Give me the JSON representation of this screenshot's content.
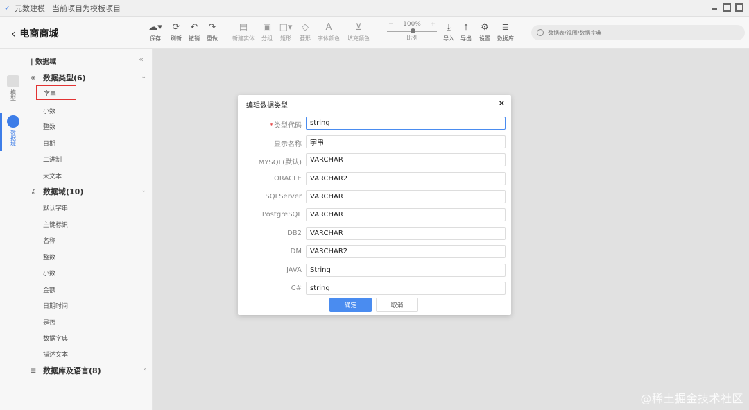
{
  "window": {
    "app_name": "元数建模",
    "project_note": "当前项目为模板项目"
  },
  "toolbar": {
    "back_title": "电商商城",
    "tools": [
      {
        "label": "保存",
        "icon": "cloud-upload-icon"
      },
      {
        "label": "刷新",
        "icon": "refresh-icon"
      },
      {
        "label": "撤销",
        "icon": "undo-icon"
      },
      {
        "label": "重做",
        "icon": "redo-icon"
      },
      {
        "label": "新建实体",
        "icon": "new-entity-icon"
      },
      {
        "label": "分组",
        "icon": "group-icon"
      },
      {
        "label": "矩形",
        "icon": "rectangle-icon"
      },
      {
        "label": "菱形",
        "icon": "diamond-icon"
      },
      {
        "label": "字体颜色",
        "icon": "font-color-icon"
      },
      {
        "label": "填充颜色",
        "icon": "fill-color-icon"
      },
      {
        "label": "导入",
        "icon": "import-icon"
      },
      {
        "label": "导出",
        "icon": "export-icon"
      },
      {
        "label": "设置",
        "icon": "gear-icon"
      },
      {
        "label": "数据库",
        "icon": "database-icon"
      }
    ],
    "zoom": {
      "minus": "−",
      "value": "100%",
      "plus": "+",
      "label": "比例"
    },
    "search_placeholder": "数据表/视图/数据字典"
  },
  "leftstrip": {
    "items": [
      {
        "label": "模型"
      },
      {
        "label": "数据域"
      }
    ]
  },
  "sidebar": {
    "header": "数据域",
    "collapse": "«",
    "groups": [
      {
        "label": "数据类型(6)",
        "icon": "cube-icon",
        "chevron": "⌄"
      },
      {
        "label": "数据域(10)",
        "icon": "key-icon",
        "chevron": "⌄"
      },
      {
        "label": "数据库及语言(8)",
        "icon": "database-icon",
        "chevron": "‹"
      }
    ],
    "data_types": [
      "字串",
      "小数",
      "整数",
      "日期",
      "二进制",
      "大文本"
    ],
    "domains": [
      "默认字串",
      "主键标识",
      "名称",
      "整数",
      "小数",
      "金额",
      "日期时间",
      "是否",
      "数据字典",
      "描述文本"
    ]
  },
  "dialog": {
    "title": "编辑数据类型",
    "close": "×",
    "fields": [
      {
        "label": "类型代码",
        "required": "*",
        "value": "string"
      },
      {
        "label": "显示名称",
        "value": "字串"
      },
      {
        "label": "MYSQL(默认)",
        "value": "VARCHAR"
      },
      {
        "label": "ORACLE",
        "value": "VARCHAR2"
      },
      {
        "label": "SQLServer",
        "value": "VARCHAR"
      },
      {
        "label": "PostgreSQL",
        "value": "VARCHAR"
      },
      {
        "label": "DB2",
        "value": "VARCHAR"
      },
      {
        "label": "DM",
        "value": "VARCHAR2"
      },
      {
        "label": "JAVA",
        "value": "String"
      },
      {
        "label": "C#",
        "value": "string"
      }
    ],
    "ok": "确定",
    "cancel": "取消"
  },
  "watermark": "@稀土掘金技术社区"
}
